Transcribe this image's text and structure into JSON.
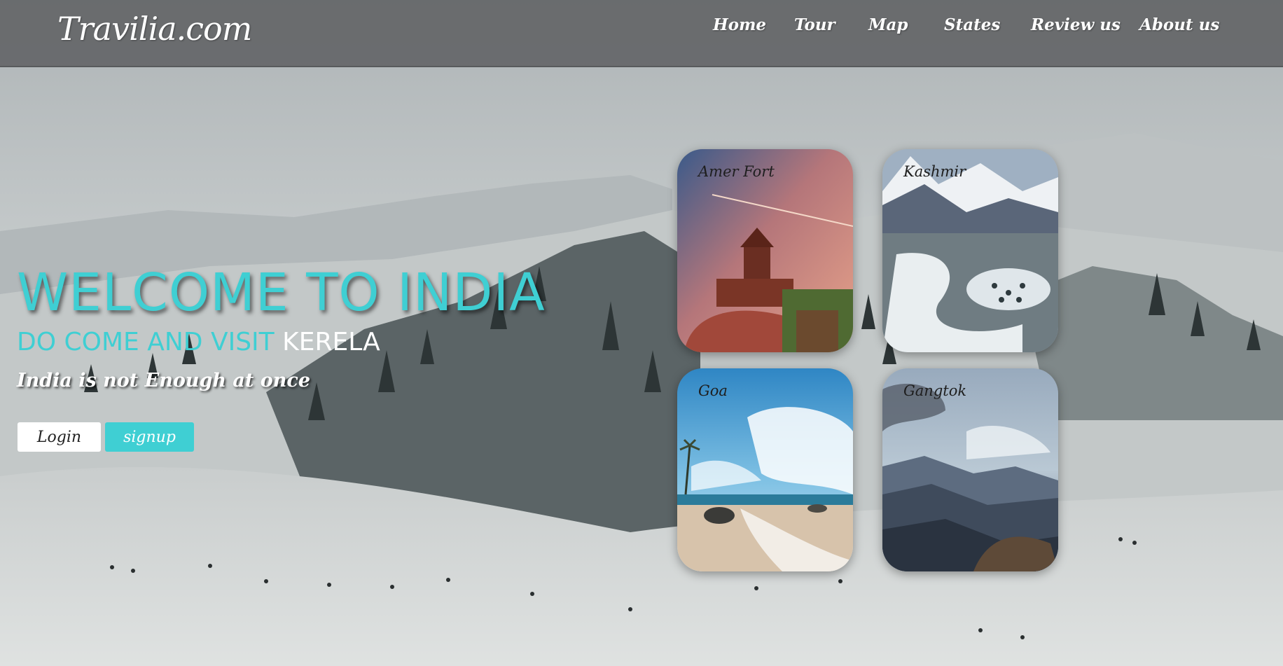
{
  "brand": "Travilia.com",
  "nav": [
    {
      "label": "Home"
    },
    {
      "label": "Tour"
    },
    {
      "label": "Map"
    },
    {
      "label": "States"
    },
    {
      "label": "Review us"
    },
    {
      "label": "About us"
    }
  ],
  "hero": {
    "title": "WELCOME TO INDIA",
    "subtitle_prefix": "DO COME AND VISIT",
    "subtitle_place": "KERELA",
    "tagline": "India is not Enough at once"
  },
  "buttons": {
    "login": "Login",
    "signup": "signup"
  },
  "cards": [
    {
      "label": "Amer Fort"
    },
    {
      "label": "Kashmir"
    },
    {
      "label": "Goa"
    },
    {
      "label": "Gangtok"
    }
  ],
  "colors": {
    "accent": "#3fcfd3",
    "navbar": "#5a5c5e"
  }
}
